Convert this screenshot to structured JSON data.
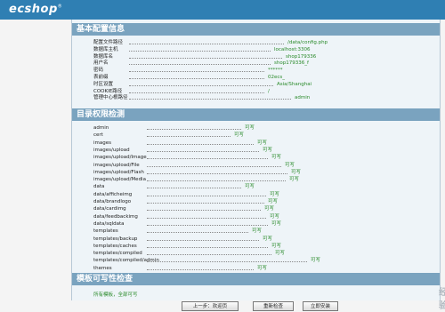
{
  "logo": "ecshop",
  "sections": {
    "basic": "基本配置信息",
    "dirs": "目录权限检测",
    "tpl": "模板可写性检查"
  },
  "basic_items": [
    {
      "label": "配置文件路径",
      "value": "/data/config.php"
    },
    {
      "label": "数据库主机",
      "value": "localhost:3306"
    },
    {
      "label": "数据库名",
      "value": "shop179336"
    },
    {
      "label": "用户名",
      "value": "shop179336_f"
    },
    {
      "label": "密码",
      "value": "******"
    },
    {
      "label": "表前缀",
      "value": "02ecs_"
    },
    {
      "label": "时区设置",
      "value": "Asia/Shanghai"
    },
    {
      "label": "COOKIE路径",
      "value": "/"
    },
    {
      "label": "管理中心根路径",
      "value": "admin"
    }
  ],
  "dir_items": [
    {
      "label": "admin",
      "status": "可写"
    },
    {
      "label": "cert",
      "status": "可写"
    },
    {
      "label": "images",
      "status": "可写"
    },
    {
      "label": "images/upload",
      "status": "可写"
    },
    {
      "label": "images/upload/Image",
      "status": "可写"
    },
    {
      "label": "images/upload/File",
      "status": "可写"
    },
    {
      "label": "images/upload/Flash",
      "status": "可写"
    },
    {
      "label": "images/upload/Media",
      "status": "可写"
    },
    {
      "label": "data",
      "status": "可写"
    },
    {
      "label": "data/afficheimg",
      "status": "可写"
    },
    {
      "label": "data/brandlogo",
      "status": "可写"
    },
    {
      "label": "data/cardimg",
      "status": "可写"
    },
    {
      "label": "data/feedbackimg",
      "status": "可写"
    },
    {
      "label": "data/sqldata",
      "status": "可写"
    },
    {
      "label": "templates",
      "status": "可写"
    },
    {
      "label": "templates/backup",
      "status": "可写"
    },
    {
      "label": "templates/caches",
      "status": "可写"
    },
    {
      "label": "templates/compiled",
      "status": "可写"
    },
    {
      "label": "templates/compiled/admin",
      "status": "可写"
    },
    {
      "label": "themes",
      "status": "可写"
    }
  ],
  "tpl_result": "所有模板，全部可写",
  "buttons": {
    "prev": "上一步：欢迎页",
    "recheck": "重新检查",
    "install": "立即安装"
  },
  "watermark": "经验"
}
